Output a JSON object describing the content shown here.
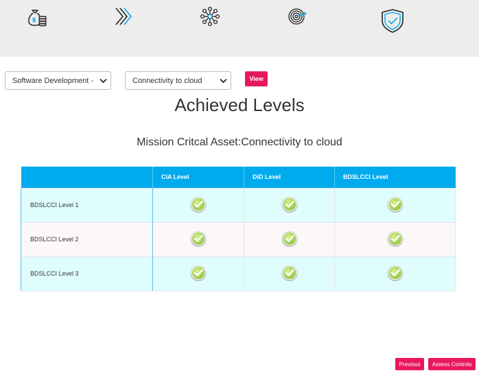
{
  "toolbar_icons": [
    "money-bag-coins-icon",
    "double-chevron-right-icon",
    "network-nodes-icon",
    "target-icon",
    "shield-check-icon"
  ],
  "filters": {
    "organization_select": "Software Development - C",
    "asset_select": "Connectivity to cloud",
    "view_label": "View"
  },
  "heading": "Achieved Levels",
  "subheading": "Mission Critcal Asset:Connectivity to cloud",
  "table": {
    "columns": [
      "",
      "CIA Level",
      "DiD Level",
      "BDSLCCI Level"
    ],
    "rows": [
      {
        "label": "BDSLCCI Level 1",
        "cia": "achieved",
        "did": "achieved",
        "bdslcci": "achieved"
      },
      {
        "label": "BDSLCCI Level 2",
        "cia": "achieved",
        "did": "achieved",
        "bdslcci": "achieved"
      },
      {
        "label": "BDSLCCI Level 3",
        "cia": "achieved",
        "did": "achieved",
        "bdslcci": "achieved"
      }
    ]
  },
  "footer": {
    "previous_label": "Previous",
    "assess_label": "Assess Controls"
  },
  "colors": {
    "accent": "#e8185d",
    "table_header": "#00aaee",
    "row_odd": "#dffdfd",
    "row_even": "#fdf8f8",
    "check_green": "#8cc63f"
  }
}
